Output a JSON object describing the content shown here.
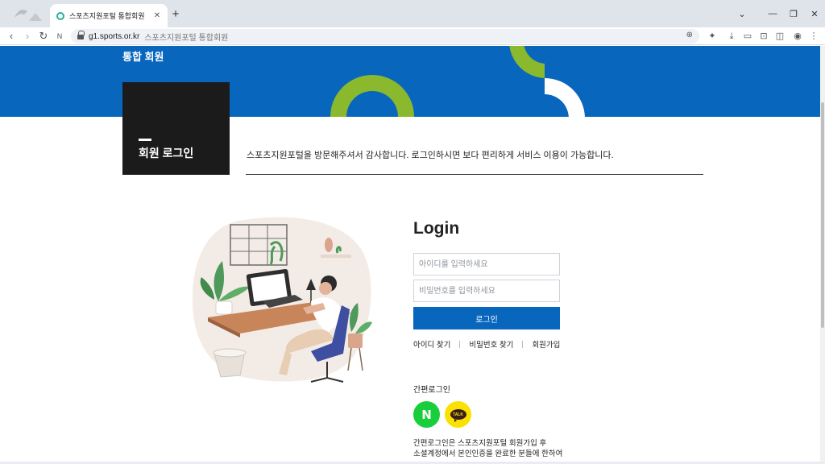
{
  "browser": {
    "tab_title": "스포츠지원포털 통합회원",
    "tab_close": "✕",
    "new_tab": "+",
    "url": "g1.sports.or.kr",
    "page_title": "스포츠지원포털 통합회원",
    "favicon_color": "#25b19a"
  },
  "header": {
    "title": "통합 회원",
    "brand_color": "#0866bd",
    "accent_green": "#8ab92d"
  },
  "section": {
    "title": "회원 로그인",
    "welcome": "스포츠지원포털을 방문해주셔서 감사합니다. 로그인하시면 보다 편리하게 서비스 이용이 가능합니다."
  },
  "login": {
    "heading": "Login",
    "id_placeholder": "아이디를 입력하세요",
    "pw_placeholder": "비밀번호를 입력하세요",
    "button_label": "로그인",
    "links": [
      "아이디 찾기",
      "비밀번호 찾기",
      "회원가입"
    ]
  },
  "easy_login": {
    "title": "간편로그인",
    "naver_label": "N",
    "naver_color": "#19ce3b",
    "kakao_label": "TALK",
    "kakao_color": "#fae100",
    "note_line1": "간편로그인은 스포츠지원포털 회원가입 후",
    "note_line2": "소셜계정에서 본인인증을 완료한 분들에 한하여"
  }
}
